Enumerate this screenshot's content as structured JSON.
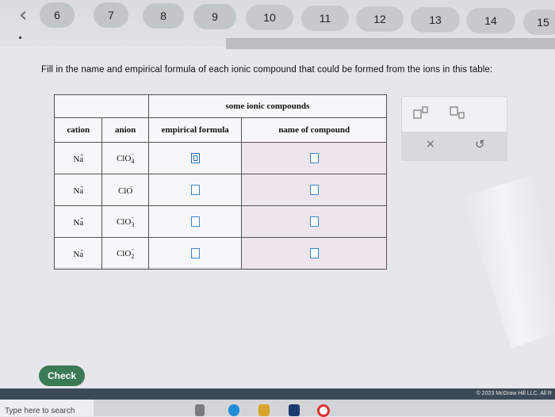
{
  "nav": {
    "questions": [
      "6",
      "7",
      "8",
      "9",
      "10",
      "11",
      "12",
      "13",
      "14",
      "15"
    ]
  },
  "question": {
    "prompt": "Fill in the name and empirical formula of each ionic compound that could be formed from the ions in this table:"
  },
  "table": {
    "caption": "some ionic compounds",
    "headers": {
      "cation": "cation",
      "anion": "anion",
      "formula": "empirical formula",
      "name": "name of compound"
    },
    "rows": [
      {
        "cation": "Na",
        "cation_charge": "+",
        "anion_base": "ClO",
        "anion_sub": "4",
        "anion_charge": "−"
      },
      {
        "cation": "Na",
        "cation_charge": "+",
        "anion_base": "ClO",
        "anion_sub": "",
        "anion_charge": "−"
      },
      {
        "cation": "Na",
        "cation_charge": "+",
        "anion_base": "ClO",
        "anion_sub": "3",
        "anion_charge": "−"
      },
      {
        "cation": "Na",
        "cation_charge": "+",
        "anion_base": "ClO",
        "anion_sub": "2",
        "anion_charge": "−"
      }
    ]
  },
  "palette": {
    "superscript_icon": "superscript-box-icon",
    "subscript_icon": "subscript-box-icon",
    "clear_symbol": "×",
    "undo_symbol": "↺"
  },
  "actions": {
    "check_label": "Check"
  },
  "footer": {
    "copyright": "© 2023 McGraw Hill LLC. All R"
  },
  "taskbar": {
    "search_placeholder": "Type here to search"
  }
}
